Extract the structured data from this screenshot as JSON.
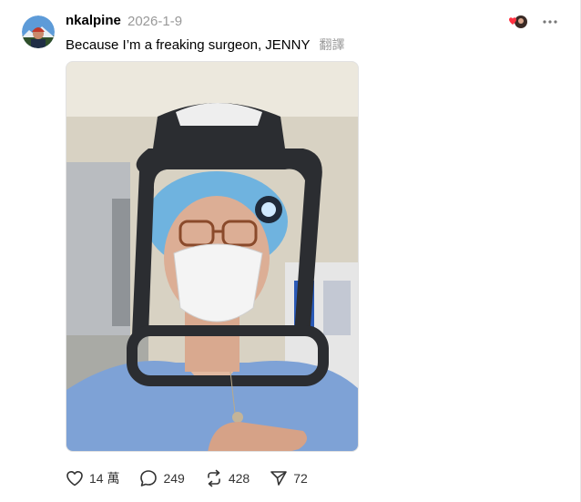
{
  "post": {
    "username": "nkalpine",
    "timestamp": "2026-1-9",
    "text": "Because I’m a freaking surgeon, JENNY",
    "translate_label": "翻譯"
  },
  "actions": {
    "likes": "14 萬",
    "comments": "249",
    "reposts": "428",
    "shares": "72"
  },
  "icons": {
    "like": "heart-icon",
    "comment": "comment-bubble-icon",
    "repost": "repost-icon",
    "share": "send-icon",
    "more": "more-dots-icon"
  },
  "colors": {
    "accent_heart": "#ff3040",
    "muted_text": "#999999"
  }
}
